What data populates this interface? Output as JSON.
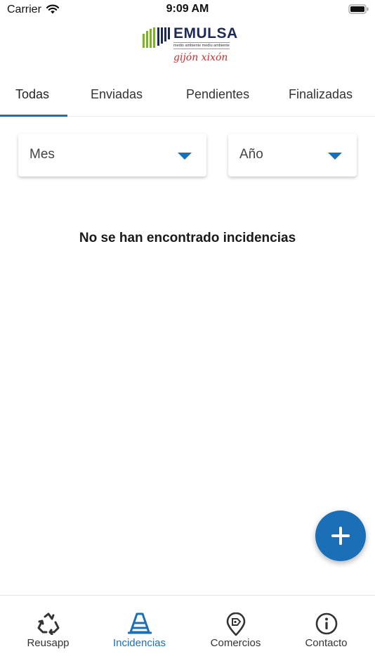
{
  "status_bar": {
    "carrier": "Carrier",
    "time": "9:09 AM"
  },
  "logo": {
    "name": "EMULSA",
    "subtitle": "medio ambiente  mediu ambiente",
    "city": "gijón xixón"
  },
  "tabs": [
    {
      "label": "Todas",
      "active": true
    },
    {
      "label": "Enviadas",
      "active": false
    },
    {
      "label": "Pendientes",
      "active": false
    },
    {
      "label": "Finalizadas",
      "active": false
    }
  ],
  "filters": {
    "month": {
      "value": "Mes"
    },
    "year": {
      "value": "Año"
    }
  },
  "empty_message": "No se han encontrado incidencias",
  "fab": {
    "icon": "plus-icon"
  },
  "bottom_nav": [
    {
      "label": "Reusapp",
      "icon": "recycle-icon",
      "active": false
    },
    {
      "label": "Incidencias",
      "icon": "traffic-cone-icon",
      "active": true
    },
    {
      "label": "Comercios",
      "icon": "map-pin-icon",
      "active": false
    },
    {
      "label": "Contacto",
      "icon": "info-icon",
      "active": false
    }
  ],
  "colors": {
    "accent": "#1b6fb6",
    "logo_green": "#7ab51d",
    "logo_navy": "#1d2a56",
    "logo_red": "#d32a2a"
  }
}
